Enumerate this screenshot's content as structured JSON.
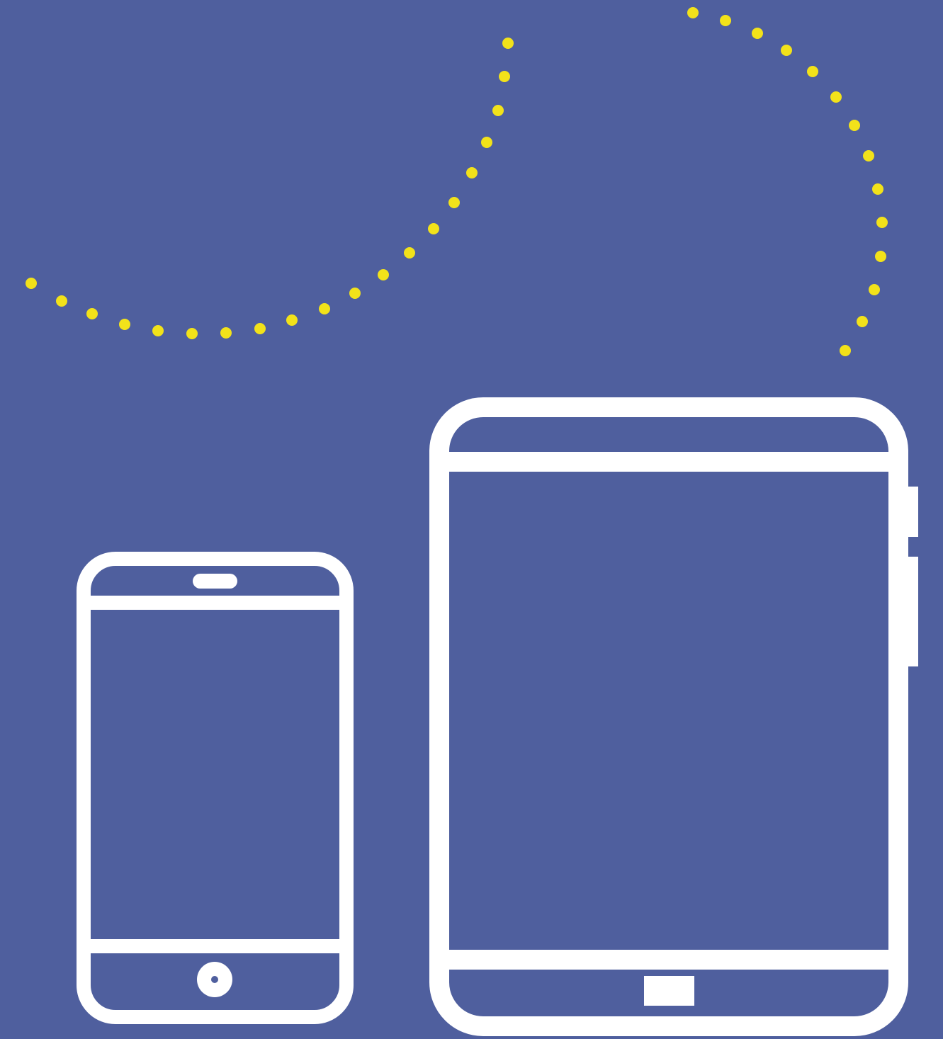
{
  "colors": {
    "background": "#4f5f9e",
    "device_outline": "#ffffff",
    "dots": "#f2e21a"
  },
  "icons": {
    "phone": "smartphone-icon",
    "tablet": "tablet-icon",
    "connection": "dotted-connection-path"
  }
}
